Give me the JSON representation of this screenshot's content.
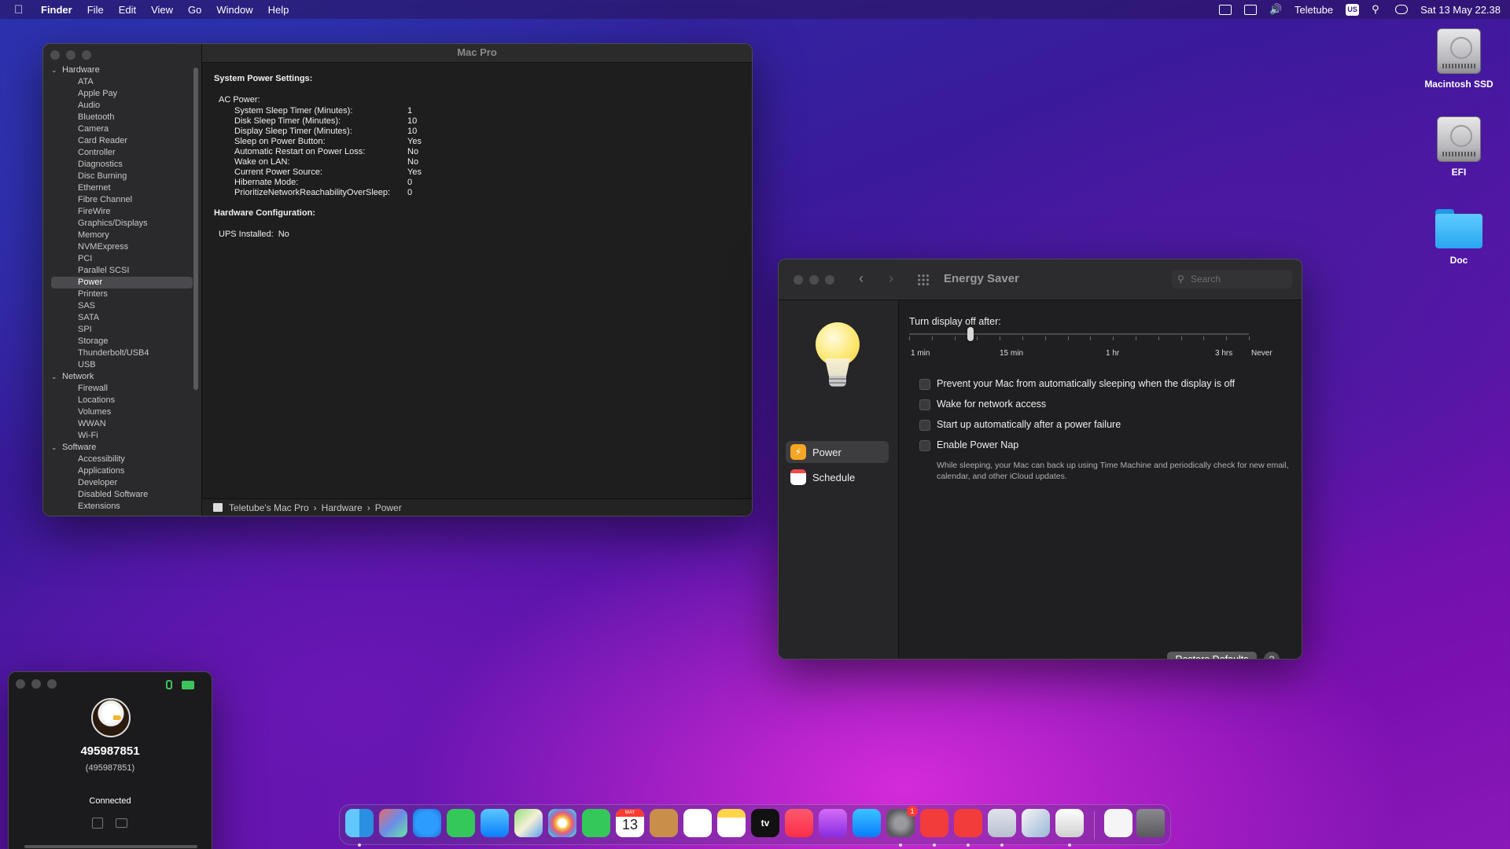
{
  "menubar": {
    "app": "Finder",
    "items": [
      "File",
      "Edit",
      "View",
      "Go",
      "Window",
      "Help"
    ],
    "user": "Teletube",
    "input_source": "US",
    "datetime": "Sat 13 May  22.38"
  },
  "desktop": {
    "icons": [
      "Macintosh SSD",
      "EFI",
      "Doc"
    ]
  },
  "sysinfo": {
    "title": "Mac Pro",
    "tree": [
      {
        "type": "group",
        "label": "Hardware"
      },
      {
        "type": "item",
        "label": "ATA"
      },
      {
        "type": "item",
        "label": "Apple Pay"
      },
      {
        "type": "item",
        "label": "Audio"
      },
      {
        "type": "item",
        "label": "Bluetooth"
      },
      {
        "type": "item",
        "label": "Camera"
      },
      {
        "type": "item",
        "label": "Card Reader"
      },
      {
        "type": "item",
        "label": "Controller"
      },
      {
        "type": "item",
        "label": "Diagnostics"
      },
      {
        "type": "item",
        "label": "Disc Burning"
      },
      {
        "type": "item",
        "label": "Ethernet"
      },
      {
        "type": "item",
        "label": "Fibre Channel"
      },
      {
        "type": "item",
        "label": "FireWire"
      },
      {
        "type": "item",
        "label": "Graphics/Displays"
      },
      {
        "type": "item",
        "label": "Memory"
      },
      {
        "type": "item",
        "label": "NVMExpress"
      },
      {
        "type": "item",
        "label": "PCI"
      },
      {
        "type": "item",
        "label": "Parallel SCSI"
      },
      {
        "type": "item",
        "label": "Power",
        "selected": true
      },
      {
        "type": "item",
        "label": "Printers"
      },
      {
        "type": "item",
        "label": "SAS"
      },
      {
        "type": "item",
        "label": "SATA"
      },
      {
        "type": "item",
        "label": "SPI"
      },
      {
        "type": "item",
        "label": "Storage"
      },
      {
        "type": "item",
        "label": "Thunderbolt/USB4"
      },
      {
        "type": "item",
        "label": "USB"
      },
      {
        "type": "group",
        "label": "Network"
      },
      {
        "type": "item",
        "label": "Firewall"
      },
      {
        "type": "item",
        "label": "Locations"
      },
      {
        "type": "item",
        "label": "Volumes"
      },
      {
        "type": "item",
        "label": "WWAN"
      },
      {
        "type": "item",
        "label": "Wi-Fi"
      },
      {
        "type": "group",
        "label": "Software"
      },
      {
        "type": "item",
        "label": "Accessibility"
      },
      {
        "type": "item",
        "label": "Applications"
      },
      {
        "type": "item",
        "label": "Developer"
      },
      {
        "type": "item",
        "label": "Disabled Software"
      },
      {
        "type": "item",
        "label": "Extensions"
      }
    ],
    "content": {
      "section1": "System Power Settings:",
      "ac_power": "AC Power:",
      "rows": [
        {
          "k": "System Sleep Timer (Minutes):",
          "v": "1"
        },
        {
          "k": "Disk Sleep Timer (Minutes):",
          "v": "10"
        },
        {
          "k": "Display Sleep Timer (Minutes):",
          "v": "10"
        },
        {
          "k": "Sleep on Power Button:",
          "v": "Yes"
        },
        {
          "k": "Automatic Restart on Power Loss:",
          "v": "No"
        },
        {
          "k": "Wake on LAN:",
          "v": "No"
        },
        {
          "k": "Current Power Source:",
          "v": "Yes"
        },
        {
          "k": "Hibernate Mode:",
          "v": "0"
        },
        {
          "k": "PrioritizeNetworkReachabilityOverSleep:",
          "v": "0"
        }
      ],
      "section2": "Hardware Configuration:",
      "ups_label": "UPS Installed:",
      "ups_value": "No"
    },
    "path": [
      "Teletube's Mac Pro",
      "Hardware",
      "Power"
    ]
  },
  "energy": {
    "title": "Energy Saver",
    "search_placeholder": "Search",
    "panes": [
      {
        "label": "Power",
        "selected": true
      },
      {
        "label": "Schedule",
        "selected": false
      }
    ],
    "display_label": "Turn display off after:",
    "slider_labels": [
      "1 min",
      "15 min",
      "1 hr",
      "3 hrs",
      "Never"
    ],
    "slider_value": "15 min",
    "options": [
      {
        "label": "Prevent your Mac from automatically sleeping when the display is off",
        "checked": false
      },
      {
        "label": "Wake for network access",
        "checked": false
      },
      {
        "label": "Start up automatically after a power failure",
        "checked": false
      },
      {
        "label": "Enable Power Nap",
        "checked": false
      }
    ],
    "power_nap_desc": "While sleeping, your Mac can back up using Time Machine and periodically check for new email, calendar, and other iCloud updates.",
    "restore_label": "Restore Defaults",
    "help_label": "?"
  },
  "teletube": {
    "id": "495987851",
    "id_sub": "(495987851)",
    "status": "Connected"
  },
  "dock": {
    "calendar_month": "MAY",
    "calendar_day": "13",
    "settings_badge": "1",
    "tv_label": "tv"
  }
}
